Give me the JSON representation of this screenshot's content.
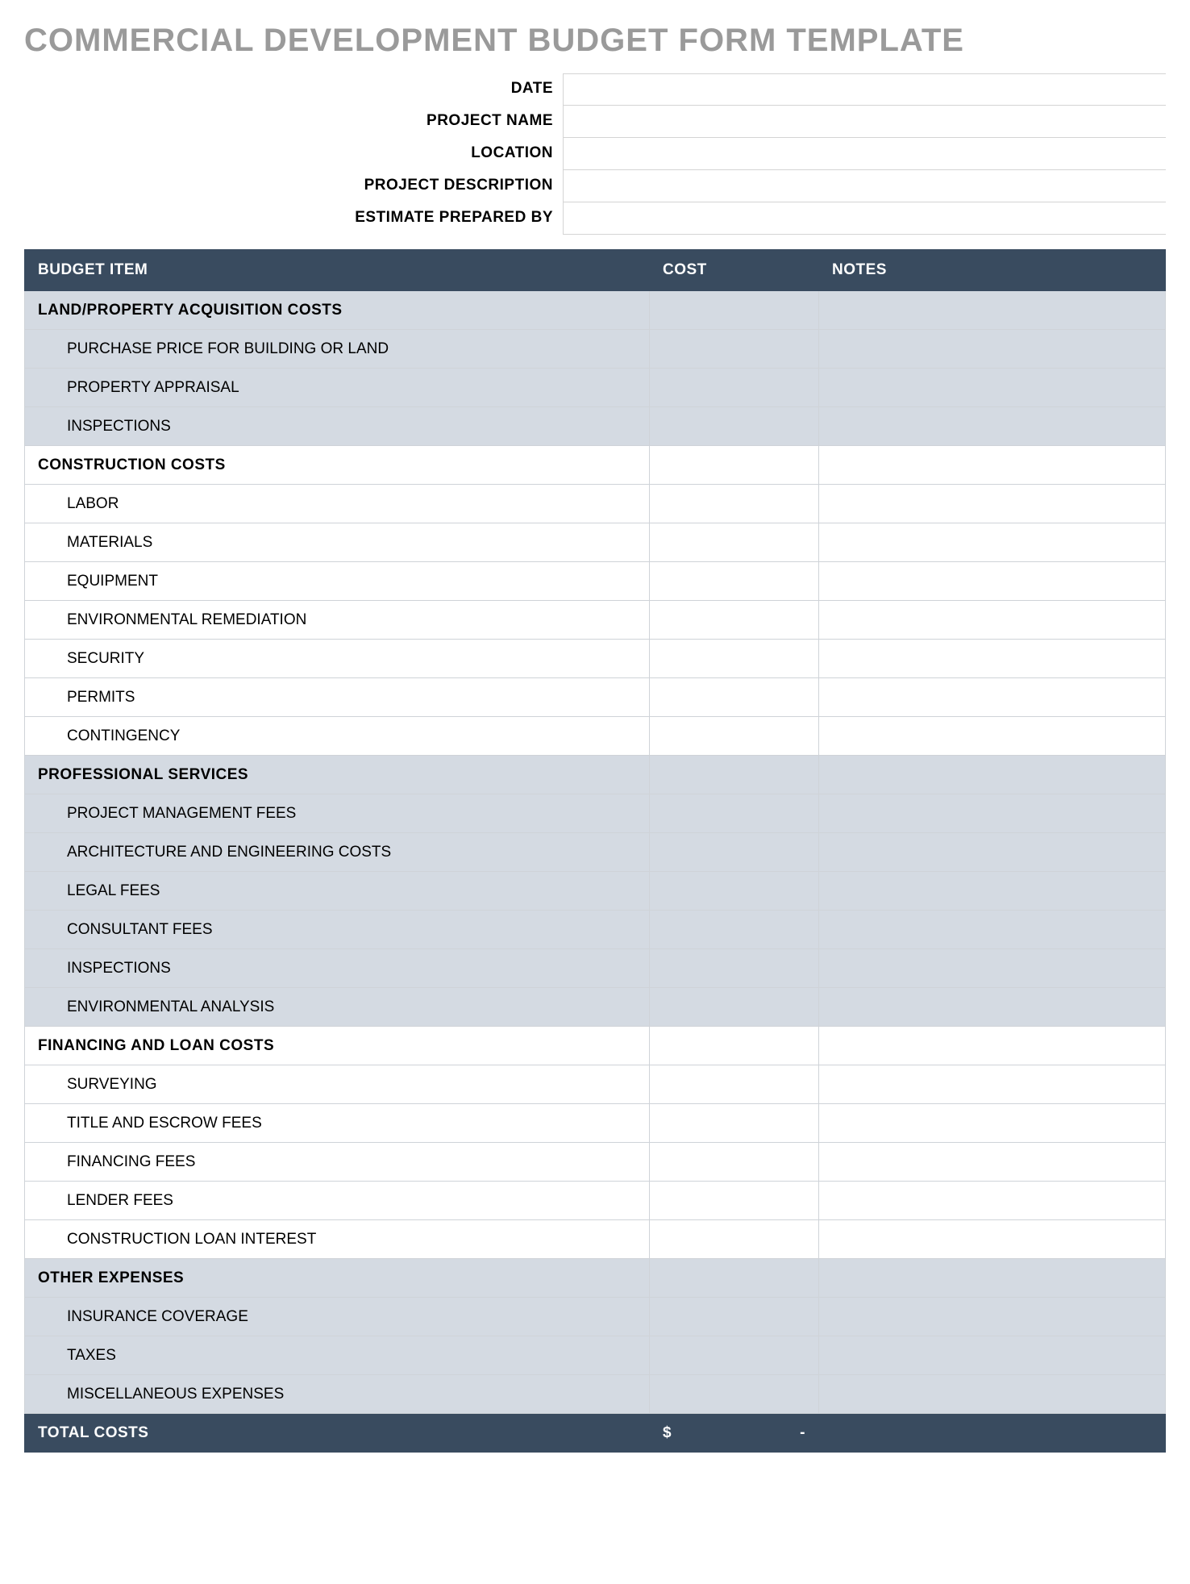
{
  "title": "COMMERCIAL DEVELOPMENT BUDGET FORM TEMPLATE",
  "meta": {
    "date_label": "DATE",
    "date_value": "",
    "project_name_label": "PROJECT NAME",
    "project_name_value": "",
    "location_label": "LOCATION",
    "location_value": "",
    "project_description_label": "PROJECT DESCRIPTION",
    "project_description_value": "",
    "estimate_prepared_by_label": "ESTIMATE PREPARED BY",
    "estimate_prepared_by_value": ""
  },
  "columns": {
    "budget_item": "BUDGET ITEM",
    "cost": "COST",
    "notes": "NOTES"
  },
  "sections": [
    {
      "name": "LAND/PROPERTY ACQUISITION COSTS",
      "shade": true,
      "items": [
        {
          "label": "PURCHASE PRICE FOR BUILDING OR LAND",
          "cost": "",
          "notes": ""
        },
        {
          "label": "PROPERTY APPRAISAL",
          "cost": "",
          "notes": ""
        },
        {
          "label": "INSPECTIONS",
          "cost": "",
          "notes": ""
        }
      ]
    },
    {
      "name": "CONSTRUCTION COSTS",
      "shade": false,
      "items": [
        {
          "label": "LABOR",
          "cost": "",
          "notes": ""
        },
        {
          "label": "MATERIALS",
          "cost": "",
          "notes": ""
        },
        {
          "label": "EQUIPMENT",
          "cost": "",
          "notes": ""
        },
        {
          "label": "ENVIRONMENTAL REMEDIATION",
          "cost": "",
          "notes": ""
        },
        {
          "label": "SECURITY",
          "cost": "",
          "notes": ""
        },
        {
          "label": "PERMITS",
          "cost": "",
          "notes": ""
        },
        {
          "label": "CONTINGENCY",
          "cost": "",
          "notes": ""
        }
      ]
    },
    {
      "name": "PROFESSIONAL SERVICES",
      "shade": true,
      "items": [
        {
          "label": "PROJECT MANAGEMENT FEES",
          "cost": "",
          "notes": ""
        },
        {
          "label": "ARCHITECTURE AND ENGINEERING COSTS",
          "cost": "",
          "notes": ""
        },
        {
          "label": "LEGAL FEES",
          "cost": "",
          "notes": ""
        },
        {
          "label": "CONSULTANT FEES",
          "cost": "",
          "notes": ""
        },
        {
          "label": "INSPECTIONS",
          "cost": "",
          "notes": ""
        },
        {
          "label": "ENVIRONMENTAL ANALYSIS",
          "cost": "",
          "notes": ""
        }
      ]
    },
    {
      "name": "FINANCING AND LOAN COSTS",
      "shade": false,
      "items": [
        {
          "label": "SURVEYING",
          "cost": "",
          "notes": ""
        },
        {
          "label": "TITLE AND ESCROW FEES",
          "cost": "",
          "notes": ""
        },
        {
          "label": "FINANCING FEES",
          "cost": "",
          "notes": ""
        },
        {
          "label": "LENDER FEES",
          "cost": "",
          "notes": ""
        },
        {
          "label": "CONSTRUCTION LOAN INTEREST",
          "cost": "",
          "notes": ""
        }
      ]
    },
    {
      "name": "OTHER EXPENSES",
      "shade": true,
      "items": [
        {
          "label": "INSURANCE COVERAGE",
          "cost": "",
          "notes": ""
        },
        {
          "label": "TAXES",
          "cost": "",
          "notes": ""
        },
        {
          "label": "MISCELLANEOUS EXPENSES",
          "cost": "",
          "notes": ""
        }
      ]
    }
  ],
  "total": {
    "label": "TOTAL COSTS",
    "currency": "$",
    "value": "-",
    "notes": ""
  }
}
